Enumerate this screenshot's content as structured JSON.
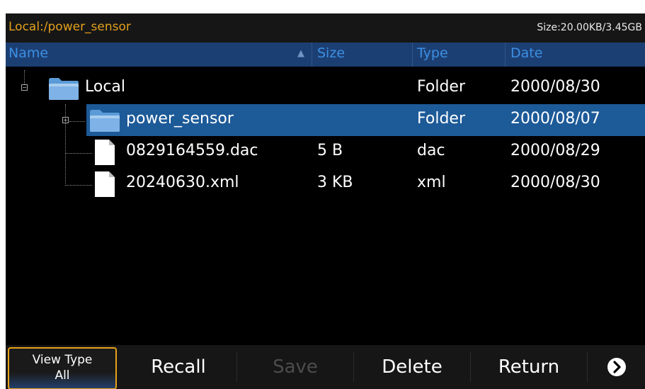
{
  "path_bar": {
    "path": "Local:/power_sensor",
    "size": "Size:20.00KB/3.45GB"
  },
  "columns": {
    "name": "Name",
    "size": "Size",
    "type": "Type",
    "date": "Date"
  },
  "rows": [
    {
      "name": "Local",
      "size": "",
      "type": "Folder",
      "date": "2000/08/30",
      "icon": "folder-icon",
      "expander": "collapse"
    },
    {
      "name": "power_sensor",
      "size": "",
      "type": "Folder",
      "date": "2000/08/07",
      "icon": "folder-icon",
      "expander": "expand",
      "selected": true
    },
    {
      "name": "0829164559.dac",
      "size": "5 B",
      "type": "dac",
      "date": "2000/08/29",
      "icon": "file-icon"
    },
    {
      "name": "20240630.xml",
      "size": "3 KB",
      "type": "xml",
      "date": "2000/08/30",
      "icon": "file-icon"
    }
  ],
  "softkeys": {
    "view_type_title": "View Type",
    "view_type_value": "All",
    "recall": "Recall",
    "save": "Save",
    "delete": "Delete",
    "return": "Return",
    "next_icon": "chevron-right-circle-icon"
  },
  "colors": {
    "accent": "#e3a01c",
    "header_bg": "#1c3f73",
    "header_text": "#3d8fe3",
    "selection": "#1d5a98"
  }
}
